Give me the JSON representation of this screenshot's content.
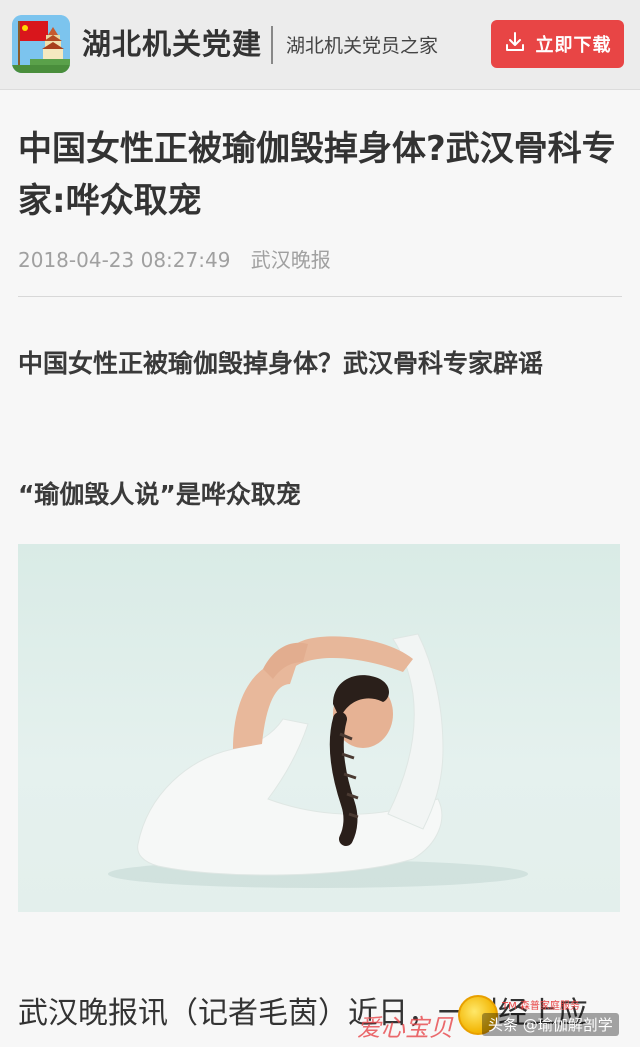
{
  "header": {
    "app_name": "湖北机关党建",
    "slogan": "湖北机关党员之家",
    "download_label": "立即下载",
    "accent_color": "#e84545"
  },
  "article": {
    "title": "中国女性正被瑜伽毁掉身体?武汉骨科专家:哗众取宠",
    "date": "2018-04-23 08:27:49",
    "source": "武汉晚报",
    "subheads": [
      "中国女性正被瑜伽毁掉身体？武汉骨科专家辟谣",
      "“瑜伽毁人说”是哗众取宠"
    ],
    "lead_text": "武汉晚报讯（记者毛茵）近日，一则经上应"
  },
  "watermarks": {
    "brand_cursive": "爱心宝贝",
    "trademark": "TM 森普家庭服务",
    "handle": "头条 @瑜伽解剖学"
  }
}
